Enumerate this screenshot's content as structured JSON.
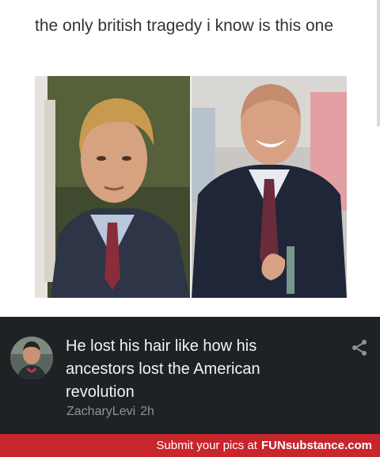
{
  "post": {
    "caption": "the only british tragedy i know is this one"
  },
  "photos": {
    "left_icon": "young-man-photo",
    "right_icon": "smiling-man-photo"
  },
  "comment": {
    "avatar_icon": "user-avatar",
    "text": "He lost his hair like how his ancestors lost the American revolution",
    "username": "ZacharyLevi",
    "time": "2h",
    "share_icon": "share-icon"
  },
  "footer": {
    "prefix": "Submit your pics at",
    "brand": "FUNsubstance.com",
    "color": "#c7262c"
  },
  "colors": {
    "comment_bg": "#1f2224",
    "comment_text": "#f2f2f2",
    "meta_text": "#8e9294",
    "caption_text": "#333333"
  }
}
